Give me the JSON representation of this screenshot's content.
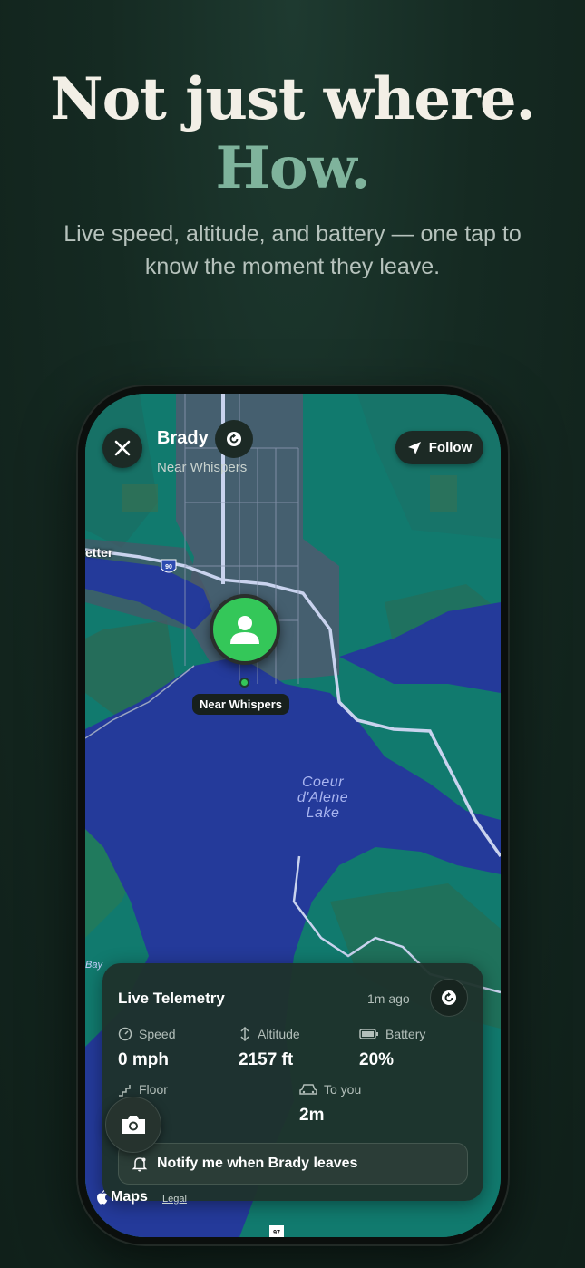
{
  "headline": {
    "line1": "Not just where.",
    "line2": "How."
  },
  "subhead": "Live speed, altitude, and battery — one tap to know the moment they leave.",
  "header": {
    "person_name": "Brady",
    "location_sub": "Near Whispers",
    "follow_label": "Follow"
  },
  "map": {
    "city_label": "etter",
    "highway_shield": "90",
    "lake_label": "Coeur d'Alene Lake",
    "bay_label": "Bay",
    "pin_label": "Near Whispers",
    "route_shield": "97",
    "brand": "Maps",
    "legal": "Legal"
  },
  "telemetry": {
    "title": "Live Telemetry",
    "updated": "1m ago",
    "speed_label": "Speed",
    "speed_value": "0 mph",
    "altitude_label": "Altitude",
    "altitude_value": "2157 ft",
    "battery_label": "Battery",
    "battery_value": "20%",
    "floor_label": "Floor",
    "floor_value": "",
    "toyou_label": "To you",
    "toyou_value": "2m",
    "notify_label": "Notify me when Brady leaves"
  },
  "colors": {
    "accent_green": "#34c759",
    "headline_accent": "#7fb39c",
    "water": "#243a9a",
    "land": "#117a6e"
  },
  "icons": [
    "close-icon",
    "refresh-icon",
    "location-arrow-icon",
    "person-icon",
    "speedometer-icon",
    "altitude-icon",
    "battery-icon",
    "stairs-icon",
    "car-icon",
    "bell-icon",
    "camera-icon",
    "apple-logo-icon"
  ]
}
